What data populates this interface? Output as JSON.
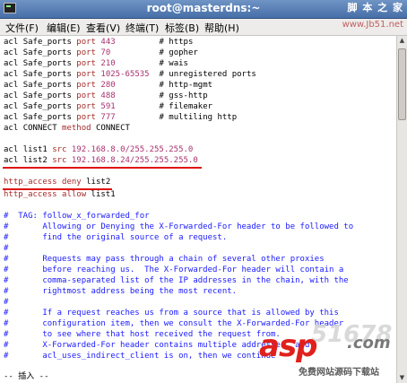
{
  "window": {
    "title": "root@masterdns:~"
  },
  "watermark": {
    "site_name": "脚 本 之 家",
    "site_url": "www.Jb51.net"
  },
  "menubar": [
    "文件(F)",
    "编辑(E)",
    "查看(V)",
    "终端(T)",
    "标签(B)",
    "帮助(H)"
  ],
  "editor": {
    "ports": [
      {
        "acl": "acl",
        "name": "Safe_ports",
        "port_kw": "port",
        "value": "443",
        "comment": "# https"
      },
      {
        "acl": "acl",
        "name": "Safe_ports",
        "port_kw": "port",
        "value": "70",
        "comment": "# gopher"
      },
      {
        "acl": "acl",
        "name": "Safe_ports",
        "port_kw": "port",
        "value": "210",
        "comment": "# wais"
      },
      {
        "acl": "acl",
        "name": "Safe_ports",
        "port_kw": "port",
        "value": "1025-65535",
        "comment": "# unregistered ports"
      },
      {
        "acl": "acl",
        "name": "Safe_ports",
        "port_kw": "port",
        "value": "280",
        "comment": "# http-mgmt"
      },
      {
        "acl": "acl",
        "name": "Safe_ports",
        "port_kw": "port",
        "value": "488",
        "comment": "# gss-http"
      },
      {
        "acl": "acl",
        "name": "Safe_ports",
        "port_kw": "port",
        "value": "591",
        "comment": "# filemaker"
      },
      {
        "acl": "acl",
        "name": "Safe_ports",
        "port_kw": "port",
        "value": "777",
        "comment": "# multiling http"
      }
    ],
    "connect_line": {
      "acl": "acl",
      "name": "CONNECT",
      "method_kw": "method",
      "value": "CONNECT"
    },
    "list1": {
      "acl": "acl",
      "name": "list1",
      "src_kw": "src",
      "value": "192.168.8.0/255.255.255.0"
    },
    "list2": {
      "acl": "acl",
      "name": "list2",
      "src_kw": "src",
      "value": "192.168.8.24/255.255.255.0"
    },
    "deny_line": {
      "directive": "http_access",
      "action": "deny",
      "target": "list2"
    },
    "allow_line": {
      "directive": "http_access",
      "action": "allow",
      "target": "list1"
    },
    "comments": [
      "#  TAG: follow_x_forwarded_for",
      "#       Allowing or Denying the X-Forwarded-For header to be followed to",
      "#       find the original source of a request.",
      "#",
      "#       Requests may pass through a chain of several other proxies",
      "#       before reaching us.  The X-Forwarded-For header will contain a",
      "#       comma-separated list of the IP addresses in the chain, with the",
      "#       rightmost address being the most recent.",
      "#",
      "#       If a request reaches us from a source that is allowed by this",
      "#       configuration item, then we consult the X-Forwarded-For header",
      "#       to see where that host received the request from.",
      "#       X-Forwarded-For header contains multiple addresses, and",
      "#       acl_uses_indirect_client is on, then we continue"
    ]
  },
  "statusline": "-- 插入 --",
  "logo": {
    "brand": "asp",
    "number": "51678",
    "suffix": ".com",
    "slogan": "免费网站源码下载站"
  },
  "colors": {
    "keyword": "#a52a2a",
    "value": "#a8326e",
    "comment": "#1a1aff",
    "underline": "#e01010"
  }
}
